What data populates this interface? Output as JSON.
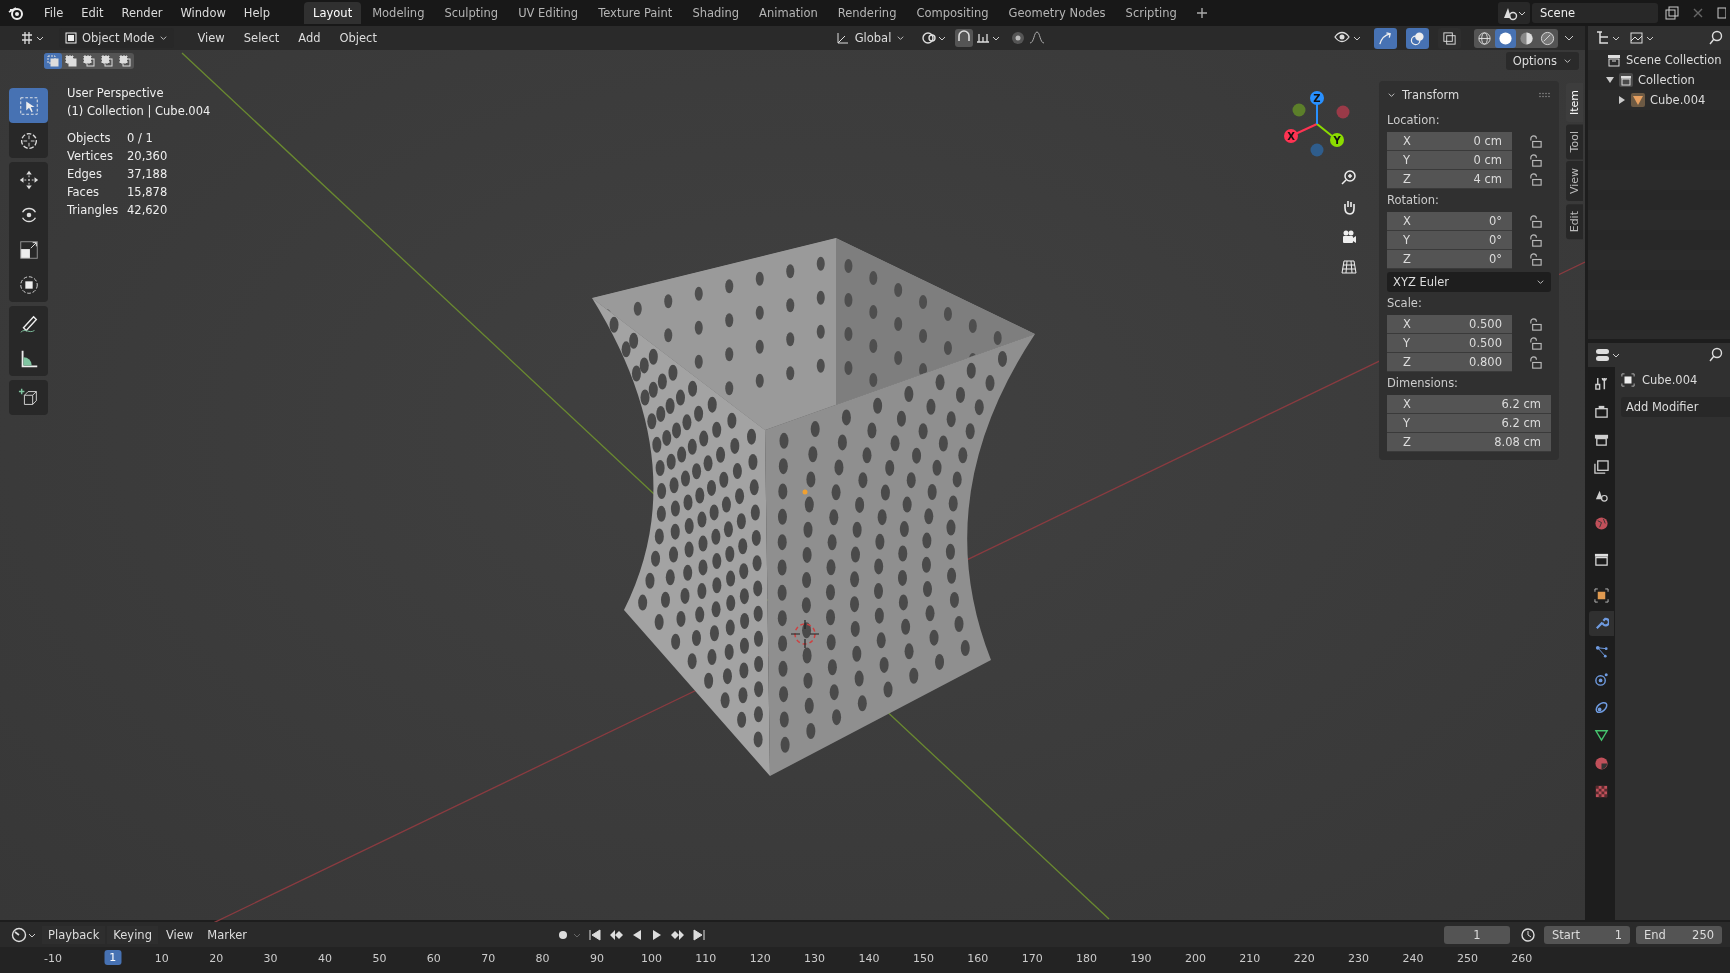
{
  "menu_bar": [
    "File",
    "Edit",
    "Render",
    "Window",
    "Help"
  ],
  "workspaces": [
    {
      "label": "Layout",
      "selected": true
    },
    {
      "label": "Modeling",
      "selected": false
    },
    {
      "label": "Sculpting",
      "selected": false
    },
    {
      "label": "UV Editing",
      "selected": false
    },
    {
      "label": "Texture Paint",
      "selected": false
    },
    {
      "label": "Shading",
      "selected": false
    },
    {
      "label": "Animation",
      "selected": false
    },
    {
      "label": "Rendering",
      "selected": false
    },
    {
      "label": "Compositing",
      "selected": false
    },
    {
      "label": "Geometry Nodes",
      "selected": false
    },
    {
      "label": "Scripting",
      "selected": false
    }
  ],
  "scene": "Scene",
  "viewport": {
    "mode": "Object Mode",
    "menus": [
      "View",
      "Select",
      "Add",
      "Object"
    ],
    "orientation": "Global",
    "toggles": [
      {
        "kind": "visibility",
        "on": false
      },
      {
        "kind": "gizmo",
        "on": true
      },
      {
        "kind": "overlay",
        "on": true
      },
      {
        "kind": "xray",
        "on": false
      }
    ],
    "shading": [
      {
        "kind": "wireframe",
        "selected": false
      },
      {
        "kind": "solid",
        "selected": true
      },
      {
        "kind": "material",
        "selected": false
      },
      {
        "kind": "rendered",
        "selected": false
      }
    ],
    "select_modes": [
      {
        "kind": "set",
        "selected": true
      },
      {
        "kind": "extend",
        "selected": false
      },
      {
        "kind": "subtract",
        "selected": false
      },
      {
        "kind": "difference",
        "selected": false
      },
      {
        "kind": "intersect",
        "selected": false
      }
    ],
    "options": "Options",
    "tool_groups": [
      [
        {
          "kind": "select_box",
          "selected": true
        },
        {
          "kind": "cursor",
          "selected": false
        }
      ],
      [
        {
          "kind": "move",
          "selected": false
        },
        {
          "kind": "rotate",
          "selected": false
        },
        {
          "kind": "scale",
          "selected": false
        },
        {
          "kind": "transform",
          "selected": false
        }
      ],
      [
        {
          "kind": "annotate",
          "selected": false
        },
        {
          "kind": "measure",
          "selected": false
        }
      ],
      [
        {
          "kind": "add_cube",
          "selected": false
        }
      ]
    ],
    "view_name": "User Perspective",
    "object_path": "(1) Collection | Cube.004",
    "stats": [
      {
        "label": "Objects",
        "value": "0 / 1"
      },
      {
        "label": "Vertices",
        "value": "20,360"
      },
      {
        "label": "Edges",
        "value": "37,188"
      },
      {
        "label": "Faces",
        "value": "15,878"
      },
      {
        "label": "Triangles",
        "value": "42,620"
      }
    ],
    "gizmo_axes": [
      {
        "label": "X",
        "color": "#ff3352"
      },
      {
        "label": "Y",
        "color": "#8bdc00"
      },
      {
        "label": "Z",
        "color": "#2890ff"
      }
    ]
  },
  "sidebar": {
    "tabs": [
      {
        "label": "Item",
        "selected": true
      },
      {
        "label": "Tool",
        "selected": false
      },
      {
        "label": "View",
        "selected": false
      },
      {
        "label": "Edit",
        "selected": false
      }
    ],
    "panel": {
      "title": "Transform",
      "sections": [
        {
          "label": "Location:",
          "fields": [
            {
              "axis": "X",
              "value": "0 cm",
              "locked": false
            },
            {
              "axis": "Y",
              "value": "0 cm",
              "locked": false
            },
            {
              "axis": "Z",
              "value": "4 cm",
              "locked": false
            }
          ]
        },
        {
          "label": "Rotation:",
          "fields": [
            {
              "axis": "X",
              "value": "0°",
              "locked": false
            },
            {
              "axis": "Y",
              "value": "0°",
              "locked": false
            },
            {
              "axis": "Z",
              "value": "0°",
              "locked": false
            }
          ],
          "dropdown": "XYZ Euler"
        },
        {
          "label": "Scale:",
          "fields": [
            {
              "axis": "X",
              "value": "0.500",
              "locked": false
            },
            {
              "axis": "Y",
              "value": "0.500",
              "locked": false
            },
            {
              "axis": "Z",
              "value": "0.800",
              "locked": false
            }
          ]
        },
        {
          "label": "Dimensions:",
          "fields": [
            {
              "axis": "X",
              "value": "6.2 cm"
            },
            {
              "axis": "Y",
              "value": "6.2 cm"
            },
            {
              "axis": "Z",
              "value": "8.08 cm"
            }
          ]
        }
      ]
    }
  },
  "outliner": {
    "tree": [
      {
        "label": "Scene Collection",
        "kind": "scene_collection",
        "children": [
          {
            "label": "Collection",
            "kind": "collection",
            "expanded": true,
            "children": [
              {
                "label": "Cube.004",
                "kind": "mesh_object",
                "expanded": false
              }
            ]
          }
        ]
      }
    ]
  },
  "properties": {
    "tabs": [
      {
        "kind": "tool",
        "selected": false
      },
      {
        "kind": "render",
        "selected": false
      },
      {
        "kind": "output",
        "selected": false
      },
      {
        "kind": "view_layer",
        "selected": false
      },
      {
        "kind": "scene",
        "selected": false
      },
      {
        "kind": "world",
        "selected": false
      },
      {
        "kind": "collection",
        "selected": false
      },
      {
        "kind": "object",
        "selected": false
      },
      {
        "kind": "modifier",
        "selected": true
      },
      {
        "kind": "particles",
        "selected": false
      },
      {
        "kind": "physics",
        "selected": false
      },
      {
        "kind": "constraints",
        "selected": false
      },
      {
        "kind": "data",
        "selected": false
      },
      {
        "kind": "material",
        "selected": false
      },
      {
        "kind": "texture",
        "selected": false
      }
    ],
    "object_name": "Cube.004",
    "add_modifier": "Add Modifier"
  },
  "timeline": {
    "menus": [
      "Playback",
      "Keying",
      "View",
      "Marker"
    ],
    "current_frame": "1",
    "start_label": "Start",
    "start": "1",
    "end_label": "End",
    "end": "250",
    "ruler_labels": [
      "-10",
      "10",
      "20",
      "30",
      "40",
      "50",
      "60",
      "70",
      "80",
      "90",
      "100",
      "110",
      "120",
      "130",
      "140",
      "150",
      "160",
      "170",
      "180",
      "190",
      "200",
      "210",
      "220",
      "230",
      "240",
      "250",
      "260"
    ],
    "playhead": "1"
  }
}
